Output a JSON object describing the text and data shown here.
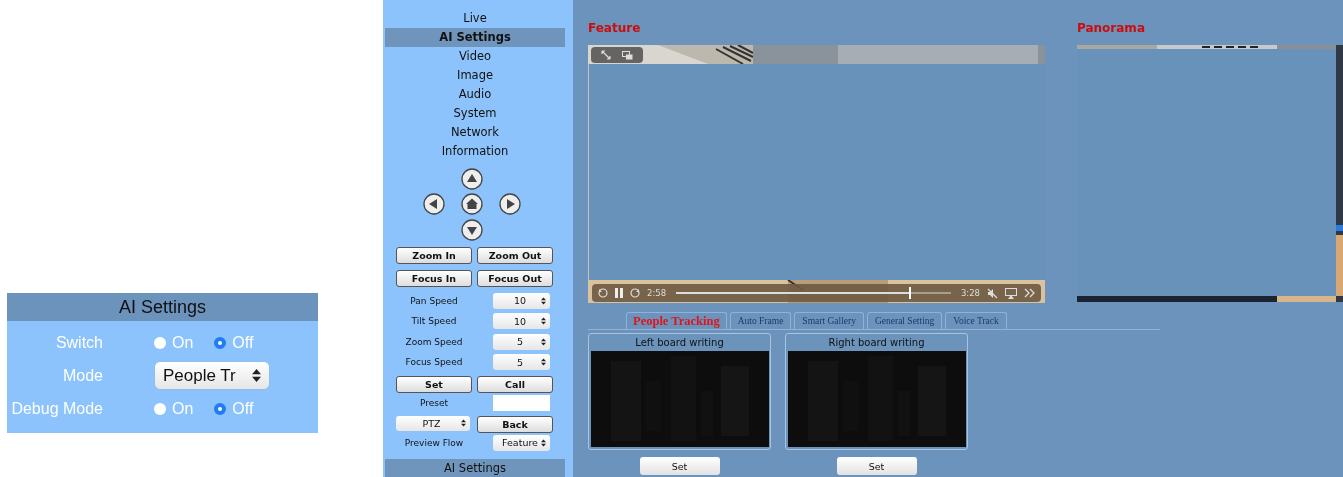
{
  "inset": {
    "title": "AI Settings",
    "rows": [
      {
        "kind": "radio",
        "label": "Switch",
        "options": [
          {
            "label": "On",
            "selected": false
          },
          {
            "label": "Off",
            "selected": true
          }
        ]
      },
      {
        "kind": "select",
        "label": "Mode",
        "value": "People Tr"
      },
      {
        "kind": "radio",
        "label": "Debug Mode",
        "options": [
          {
            "label": "On",
            "selected": false
          },
          {
            "label": "Off",
            "selected": true
          }
        ]
      }
    ]
  },
  "sidebar": {
    "menu": [
      {
        "label": "Live",
        "selected": false
      },
      {
        "label": "AI Settings",
        "selected": true
      },
      {
        "label": "Video",
        "selected": false
      },
      {
        "label": "Image",
        "selected": false
      },
      {
        "label": "Audio",
        "selected": false
      },
      {
        "label": "System",
        "selected": false
      },
      {
        "label": "Network",
        "selected": false
      },
      {
        "label": "Information",
        "selected": false
      }
    ],
    "zoom_buttons": [
      "Zoom In",
      "Zoom Out"
    ],
    "focus_buttons": [
      "Focus In",
      "Focus Out"
    ],
    "speeds": [
      {
        "label": "Pan Speed",
        "value": "10"
      },
      {
        "label": "Tilt Speed",
        "value": "10"
      },
      {
        "label": "Zoom Speed",
        "value": "5"
      },
      {
        "label": "Focus Speed",
        "value": "5"
      }
    ],
    "preset_buttons": [
      "Set",
      "Call"
    ],
    "preset": {
      "label": "Preset"
    },
    "mode_select": {
      "value": "PTZ"
    },
    "back_button": "Back",
    "preview_flow": {
      "label": "Preview Flow",
      "value": "Feature"
    },
    "footer": "AI Settings"
  },
  "feature": {
    "title": "Feature",
    "player": {
      "current_time": "2:58",
      "duration": "3:28",
      "level": 0.85
    }
  },
  "panorama": {
    "title": "Panorama"
  },
  "tabs": [
    {
      "label": "People Tracking",
      "selected": true
    },
    {
      "label": "Auto Frame",
      "selected": false
    },
    {
      "label": "Smart Gallery",
      "selected": false
    },
    {
      "label": "General Setting",
      "selected": false
    },
    {
      "label": "Voice Track",
      "selected": false
    }
  ],
  "boards": [
    {
      "title": "Left board writing",
      "button": "Set"
    },
    {
      "title": "Right board writing",
      "button": "Set"
    }
  ]
}
